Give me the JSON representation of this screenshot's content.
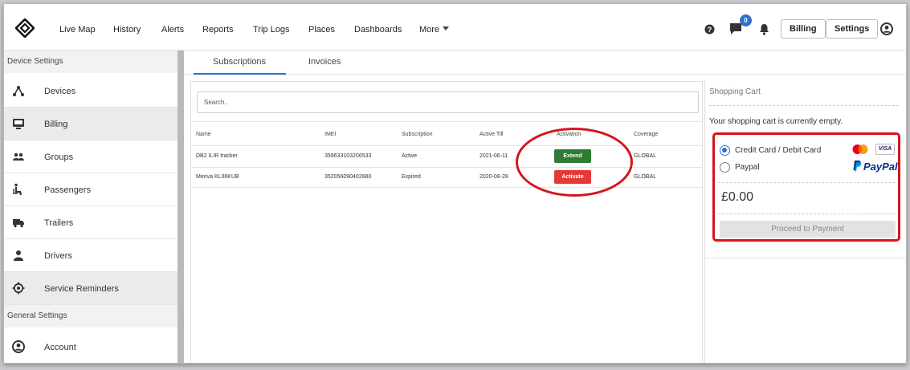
{
  "nav": {
    "items": [
      "Live Map",
      "History",
      "Alerts",
      "Reports",
      "Trip Logs",
      "Places",
      "Dashboards"
    ],
    "more_label": "More",
    "chat_badge": "0",
    "billing_label": "Billing",
    "settings_label": "Settings"
  },
  "sidebar": {
    "device_settings_header": "Device Settings",
    "items": [
      {
        "label": "Devices",
        "icon": "devices-icon"
      },
      {
        "label": "Billing",
        "icon": "billing-icon"
      },
      {
        "label": "Groups",
        "icon": "groups-icon"
      },
      {
        "label": "Passengers",
        "icon": "passengers-icon"
      },
      {
        "label": "Trailers",
        "icon": "trailer-icon"
      },
      {
        "label": "Drivers",
        "icon": "driver-icon"
      },
      {
        "label": "Service Reminders",
        "icon": "service-icon"
      }
    ],
    "general_settings_header": "General Settings",
    "account_label": "Account"
  },
  "tabs": {
    "subscriptions": "Subscriptions",
    "invoices": "Invoices"
  },
  "table": {
    "search_placeholder": "Search..",
    "headers": [
      "Name",
      "IMEI",
      "Subscription",
      "Active Till",
      "Activation",
      "Coverage"
    ],
    "rows": [
      {
        "name": "DB2 ILIR tracker",
        "imei": "359633103206533",
        "subscription": "Active",
        "active_till": "2021-06-11",
        "action": "Extend",
        "coverage": "GLOBAL"
      },
      {
        "name": "Meriva KL06KUB",
        "imei": "352056090402880",
        "subscription": "Expired",
        "active_till": "2020-08-28",
        "action": "Activate",
        "coverage": "GLOBAL"
      }
    ]
  },
  "cart": {
    "title": "Shopping Cart",
    "empty_message": "Your shopping cart is currently empty.",
    "option_card": "Credit Card / Debit Card",
    "option_paypal": "Paypal",
    "paypal_logo_text": "PayPal",
    "visa_logo_text": "VISA",
    "amount": "£0.00",
    "proceed_label": "Proceed to Payment"
  },
  "colors": {
    "accent": "#2f6fd1",
    "extend_button": "#2e7d32",
    "activate_button": "#e53935",
    "highlight": "#d4151b"
  }
}
